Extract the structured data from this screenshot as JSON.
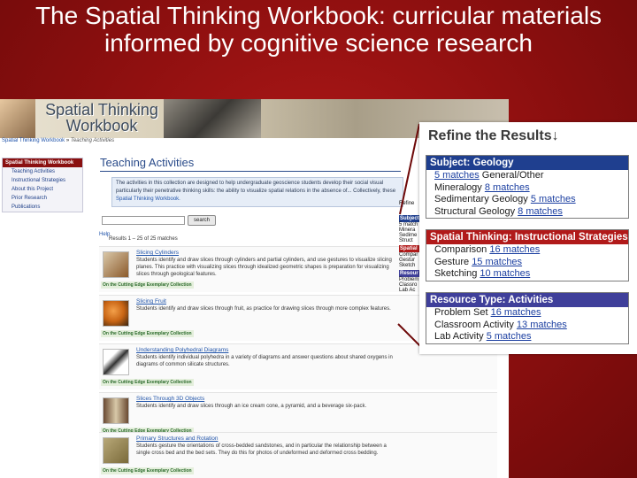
{
  "slide": {
    "title": "The Spatial Thinking Workbook: curricular materials informed by cognitive science research"
  },
  "site": {
    "logo": "Spatial Thinking Workbook",
    "breadcrumb_root": "Spatial Thinking Workbook",
    "breadcrumb_sep": " » ",
    "breadcrumb_current": "Teaching Activities",
    "nav_title": "Spatial Thinking Workbook",
    "nav_items": [
      "Teaching Activities",
      "Instructional Strategies",
      "About this Project",
      "Prior Research",
      "Publications"
    ],
    "page_title": "Teaching Activities",
    "intro_text": "The activities in this collection are designed to help undergraduate geoscience students develop their social visual",
    "intro_text_2": "particularly their penetrative thinking skills: the ability to visualize spatial relations in the absence of... Collectively, these",
    "intro_link": "Spatial Thinking Workbook.",
    "search_button": "search",
    "help": "Help",
    "results_count": "Results 1 – 25 of 25 matches",
    "collection_tag": "On the Cutting Edge Exemplary Collection",
    "results": [
      {
        "title": "Slicing Cylinders",
        "desc": "Students identify and draw slices through cylinders and partial cylinders, and use gestures to visualize slicing planes. This practice with visualizing slices through idealized geometric shapes is preparation for visualizing slices through geological features.",
        "color": "#8b5a2b"
      },
      {
        "title": "Slicing Fruit",
        "desc": "Students identify and draw slices through fruit, as practice for drawing slices through more complex features.",
        "color": "#c86414"
      },
      {
        "title": "Understanding Polyhedral Diagrams",
        "desc": "Students identify individual polyhedra in a variety of diagrams and answer questions about shared oxygens in diagrams of common silicate structures.",
        "color": "#333333"
      },
      {
        "title": "Slices Through 3D Objects",
        "desc": "Students identify and draw slices through an ice cream cone, a pyramid, and a beverage six-pack.",
        "color": "#6a4a32"
      },
      {
        "title": "Primary Structures and Rotation",
        "desc": "Students gesture the orientations of cross-bedded sandstones, and in particular the relationship between a single cross bed and the bed sets. They do this for photos of undeformed and deformed cross bedding.",
        "color": "#7a6a3a"
      }
    ],
    "partial_labels": [
      "Refine",
      "Subject",
      "5 match",
      "Minera",
      "Sedime",
      "Struct",
      "Spatial",
      "Compar",
      "Gestur",
      "Sketch",
      "Resour",
      "Problem",
      "Classro",
      "Lab Ac"
    ]
  },
  "refine": {
    "title": "Refine the Results",
    "arrow_glyph": "↓",
    "facets": [
      {
        "heading": "Subject: Geology",
        "heading_color": "#1f3f8f",
        "rows": [
          {
            "pre": "",
            "match": "5 matches",
            "post": " General/Other"
          },
          {
            "pre": "Mineralogy ",
            "match": "8 matches",
            "post": ""
          },
          {
            "pre": "Sedimentary Geology ",
            "match": "5 matches",
            "post": ""
          },
          {
            "pre": "Structural Geology ",
            "match": "8 matches",
            "post": ""
          }
        ]
      },
      {
        "heading": "Spatial Thinking: Instructional Strategies",
        "heading_color": "#b11a1a",
        "rows": [
          {
            "pre": "Comparison ",
            "match": "16 matches",
            "post": ""
          },
          {
            "pre": "Gesture ",
            "match": "15 matches",
            "post": ""
          },
          {
            "pre": "Sketching ",
            "match": "10 matches",
            "post": ""
          }
        ]
      },
      {
        "heading": "Resource Type: Activities",
        "heading_color": "#3f3f9a",
        "rows": [
          {
            "pre": "Problem Set ",
            "match": "16 matches",
            "post": ""
          },
          {
            "pre": "Classroom Activity ",
            "match": "13 matches",
            "post": ""
          },
          {
            "pre": "Lab Activity ",
            "match": "5 matches",
            "post": ""
          }
        ]
      }
    ]
  }
}
